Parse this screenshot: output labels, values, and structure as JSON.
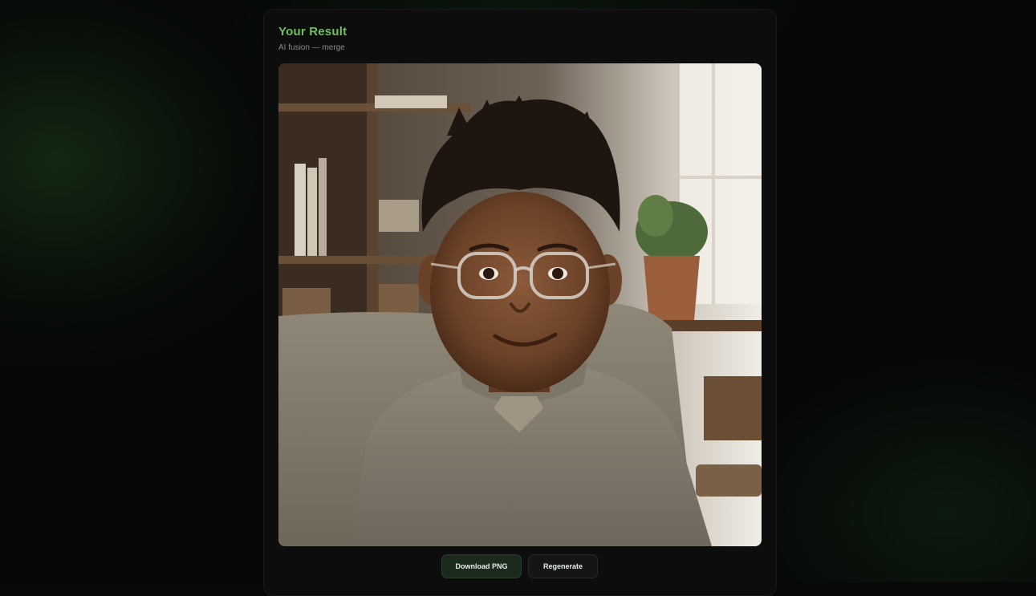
{
  "result": {
    "title": "Your Result",
    "subtitle": "AI fusion — merge",
    "image_icon": "generated-portrait",
    "colors": {
      "accent": "#6fbf5f",
      "card_bg": "#0c0d0c",
      "download_bg": "#1a2a1c",
      "regenerate_bg": "#141614"
    }
  },
  "actions": {
    "download_label": "Download PNG",
    "regenerate_label": "Regenerate"
  }
}
